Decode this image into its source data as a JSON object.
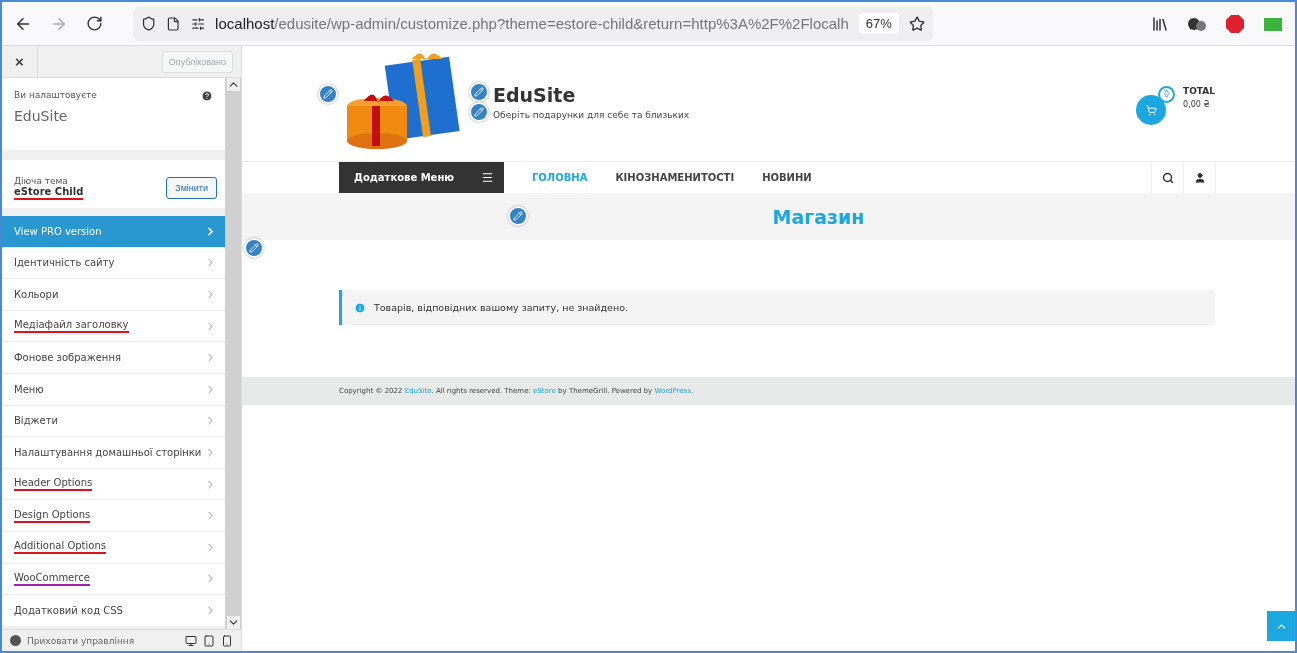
{
  "browser": {
    "url_host": "localhost",
    "url_path": "/edusite/wp-admin/customize.php?theme=estore-child&return=http%3A%2F%2Flocalh",
    "zoom": "67%"
  },
  "sidebar": {
    "close": "×",
    "publish_button": "Опубліковано",
    "publish_disabled": true,
    "customizing_label": "Ви налаштовуєте",
    "site_name": "EduSite",
    "theme_label": "Діюча тема",
    "theme": {
      "name": "eStore Child",
      "color": "#e0101c"
    },
    "change_button": "Змінити",
    "items": [
      {
        "label": "View PRO version",
        "kind": "promo"
      },
      {
        "label": "Ідентичність сайту",
        "kind": "section"
      },
      {
        "label": "Кольори",
        "kind": "section"
      },
      {
        "label": "Медіафайл заголовку",
        "kind": "section",
        "color": "#e0101c"
      },
      {
        "label": "Фонове зображення",
        "kind": "section"
      },
      {
        "label": "Меню",
        "kind": "section"
      },
      {
        "label": "Віджети",
        "kind": "section"
      },
      {
        "label": "Налаштування домашньої сторінки",
        "kind": "section"
      },
      {
        "label": "Header Options",
        "kind": "section",
        "color": "#e0101c"
      },
      {
        "label": "Design Options",
        "kind": "section",
        "color": "#e0101c"
      },
      {
        "label": "Additional Options",
        "kind": "section",
        "color": "#e0101c"
      },
      {
        "label": "WooCommerce",
        "kind": "section",
        "color": "#a020b0"
      },
      {
        "label": "Додатковий код CSS",
        "kind": "section"
      }
    ],
    "hide_controls": "Приховати управління"
  },
  "site": {
    "title": "EduSite",
    "tagline": "Оберіть подарунки для себе та близьких",
    "cart_count": "0",
    "total_label": "TOTAL",
    "total_value": "0,00 ₴",
    "extra_menu": "Додаткове Меню",
    "nav": [
      {
        "label": "ГОЛОВНА",
        "selected": true
      },
      {
        "label": "КІНОЗНАМЕНИТОСТІ",
        "selected": false
      },
      {
        "label": "НОВИНИ",
        "selected": false
      }
    ],
    "page_title": "Магазин",
    "notice": "Товарів, відповідних вашому запиту, не знайдено.",
    "footer": [
      {
        "text": "Copyright © 2022 ",
        "kind": "text"
      },
      {
        "text": "EduSite",
        "kind": "link"
      },
      {
        "text": ". All rights reserved. Theme: ",
        "kind": "text"
      },
      {
        "text": "eStore",
        "kind": "link"
      },
      {
        "text": " by ThemeGrill. Powered by ",
        "kind": "text"
      },
      {
        "text": "WordPress",
        "kind": "link"
      },
      {
        "text": ".",
        "kind": "text"
      }
    ]
  }
}
